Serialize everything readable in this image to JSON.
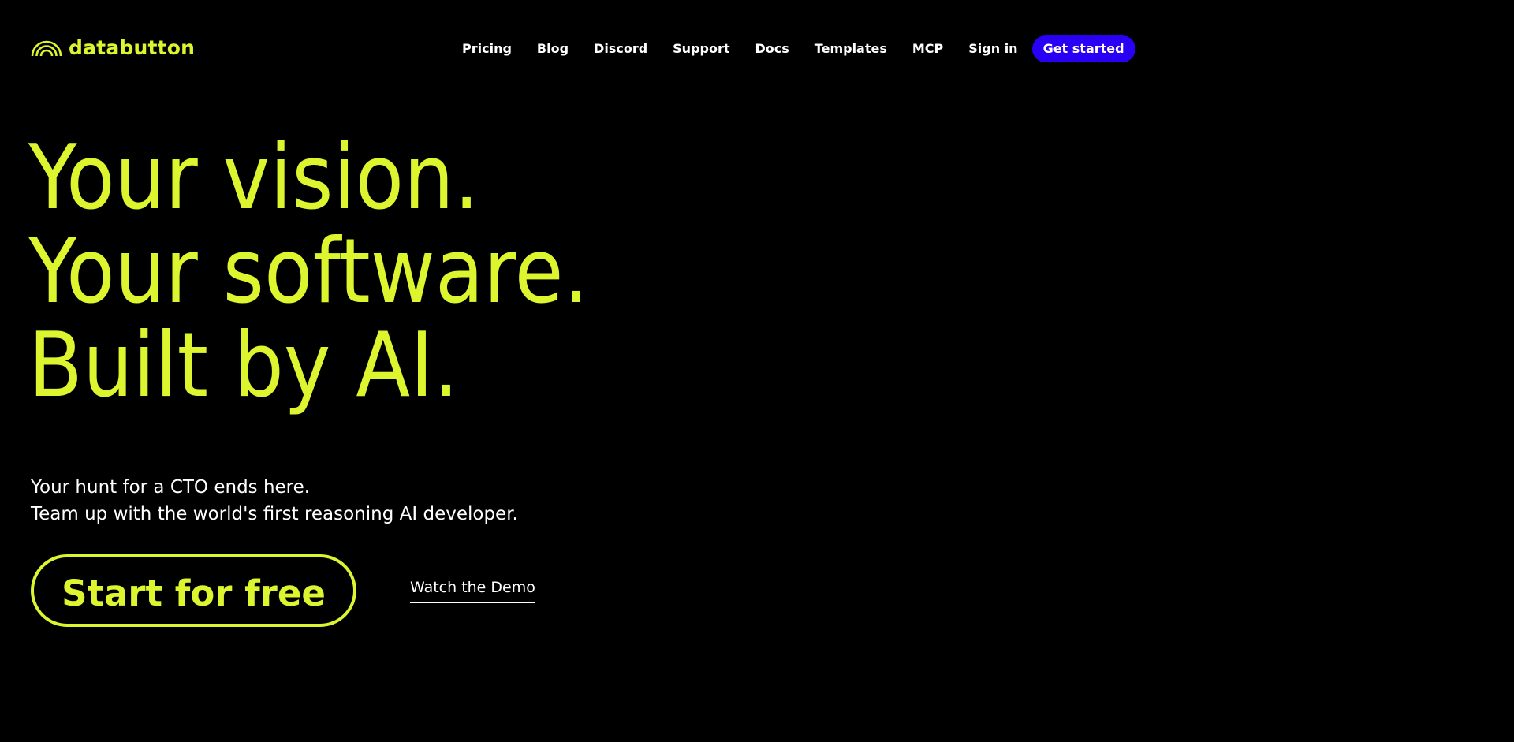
{
  "brand": {
    "name": "databutton",
    "logo_icon": "rainbow-arcs-icon",
    "accent_color": "#dcf52e",
    "cta_color": "#2a00f5",
    "background_color": "#000000"
  },
  "nav": {
    "items": [
      {
        "label": "Pricing"
      },
      {
        "label": "Blog"
      },
      {
        "label": "Discord"
      },
      {
        "label": "Support"
      },
      {
        "label": "Docs"
      },
      {
        "label": "Templates"
      },
      {
        "label": "MCP"
      },
      {
        "label": "Sign in"
      }
    ],
    "cta_label": "Get started"
  },
  "hero": {
    "title_lines": [
      "Your vision.",
      "Your software.",
      "Built by AI."
    ],
    "subtitle_lines": [
      "Your hunt for a CTO ends here.",
      "Team up with the world's first reasoning AI developer."
    ],
    "primary_button_label": "Start for free",
    "secondary_link_label": "Watch the Demo"
  }
}
